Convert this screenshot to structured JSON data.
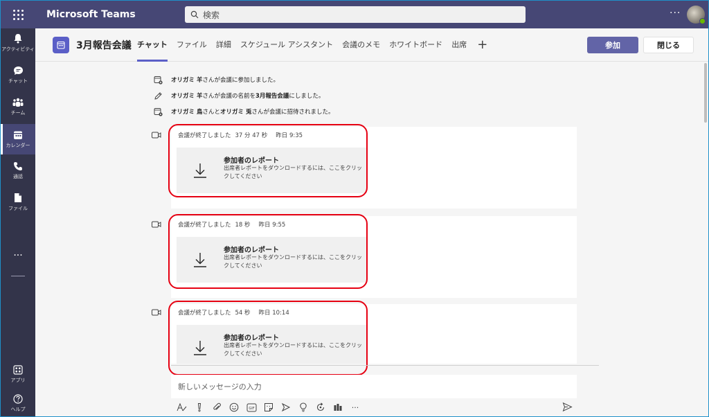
{
  "app": {
    "title": "Microsoft Teams"
  },
  "search": {
    "placeholder": "検索"
  },
  "topbar": {
    "more": "···"
  },
  "rail": {
    "items": [
      {
        "label": "アクティビティ",
        "icon": "bell-icon"
      },
      {
        "label": "チャット",
        "icon": "chat-icon"
      },
      {
        "label": "チーム",
        "icon": "teams-icon"
      },
      {
        "label": "カレンダー",
        "icon": "calendar-icon",
        "active": true
      },
      {
        "label": "通話",
        "icon": "phone-icon"
      },
      {
        "label": "ファイル",
        "icon": "file-icon"
      }
    ],
    "more": "···",
    "apps_label": "アプリ",
    "help_label": "ヘルプ"
  },
  "header": {
    "title": "3月報告会議",
    "tabs": [
      "チャット",
      "ファイル",
      "詳細",
      "スケジュール アシスタント",
      "会議のメモ",
      "ホワイトボード",
      "出席"
    ],
    "add_tab": "+",
    "join_label": "参加",
    "close_label": "閉じる"
  },
  "events": [
    {
      "name": "オリガミ 羊",
      "text": " さんが会議に参加しました。"
    },
    {
      "name": "オリガミ 羊",
      "text": " さんが会議の名前を ",
      "name2": "3月報告会議",
      "text2": " にしました。"
    },
    {
      "name": "オリガミ 鳥",
      "text": " さんと ",
      "name2": "オリガミ 兎",
      "text2": " さんが会議に招待されました。"
    }
  ],
  "meetings": [
    {
      "status": "会議が終了しました",
      "duration": "37 分 47 秒",
      "time": "昨日 9:35"
    },
    {
      "status": "会議が終了しました",
      "duration": "18 秒",
      "time": "昨日 9:55"
    },
    {
      "status": "会議が終了しました",
      "duration": "54 秒",
      "time": "昨日 10:14"
    }
  ],
  "report": {
    "title": "参加者のレポート",
    "desc": "出席者レポートをダウンロードするには、ここをクリックしてください"
  },
  "compose": {
    "placeholder": "新しいメッセージの入力"
  },
  "colors": {
    "topbar": "#464775",
    "rail": "#33344a",
    "accent": "#6264a7",
    "highlight": "#e60012"
  }
}
